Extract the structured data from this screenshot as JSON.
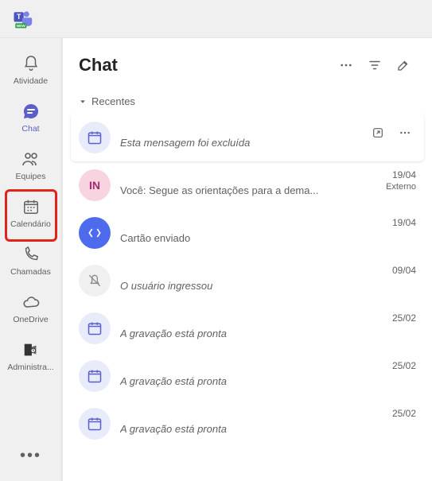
{
  "rail": {
    "items": [
      {
        "id": "activity",
        "label": "Atividade"
      },
      {
        "id": "chat",
        "label": "Chat"
      },
      {
        "id": "teams",
        "label": "Equipes"
      },
      {
        "id": "calendar",
        "label": "Calendário"
      },
      {
        "id": "calls",
        "label": "Chamadas"
      },
      {
        "id": "onedrive",
        "label": "OneDrive"
      },
      {
        "id": "admin",
        "label": "Administra..."
      }
    ],
    "more": "•••"
  },
  "header": {
    "title": "Chat"
  },
  "section": {
    "recent": "Recentes"
  },
  "chats": [
    {
      "avatar": "cal",
      "title": "",
      "preview": "Esta mensagem foi excluída",
      "preview_italic": true,
      "date": "",
      "tag": "",
      "selected": true,
      "show_actions": true
    },
    {
      "avatar": "pink",
      "initials": "IN",
      "title": "",
      "preview": "Você: Segue as orientações para a dema...",
      "preview_italic": false,
      "date": "19/04",
      "tag": "Externo"
    },
    {
      "avatar": "blue",
      "title": "",
      "preview": "Cartão enviado",
      "preview_italic": false,
      "date": "19/04",
      "tag": ""
    },
    {
      "avatar": "muted",
      "title": "",
      "preview": "O usuário ingressou",
      "preview_italic": true,
      "date": "09/04",
      "tag": ""
    },
    {
      "avatar": "cal",
      "title": "",
      "preview": "A gravação está pronta",
      "preview_italic": true,
      "date": "25/02",
      "tag": ""
    },
    {
      "avatar": "cal",
      "title": "",
      "preview": "A gravação está pronta",
      "preview_italic": true,
      "date": "25/02",
      "tag": ""
    },
    {
      "avatar": "cal",
      "title": "",
      "preview": "A gravação está pronta",
      "preview_italic": true,
      "date": "25/02",
      "tag": ""
    }
  ]
}
